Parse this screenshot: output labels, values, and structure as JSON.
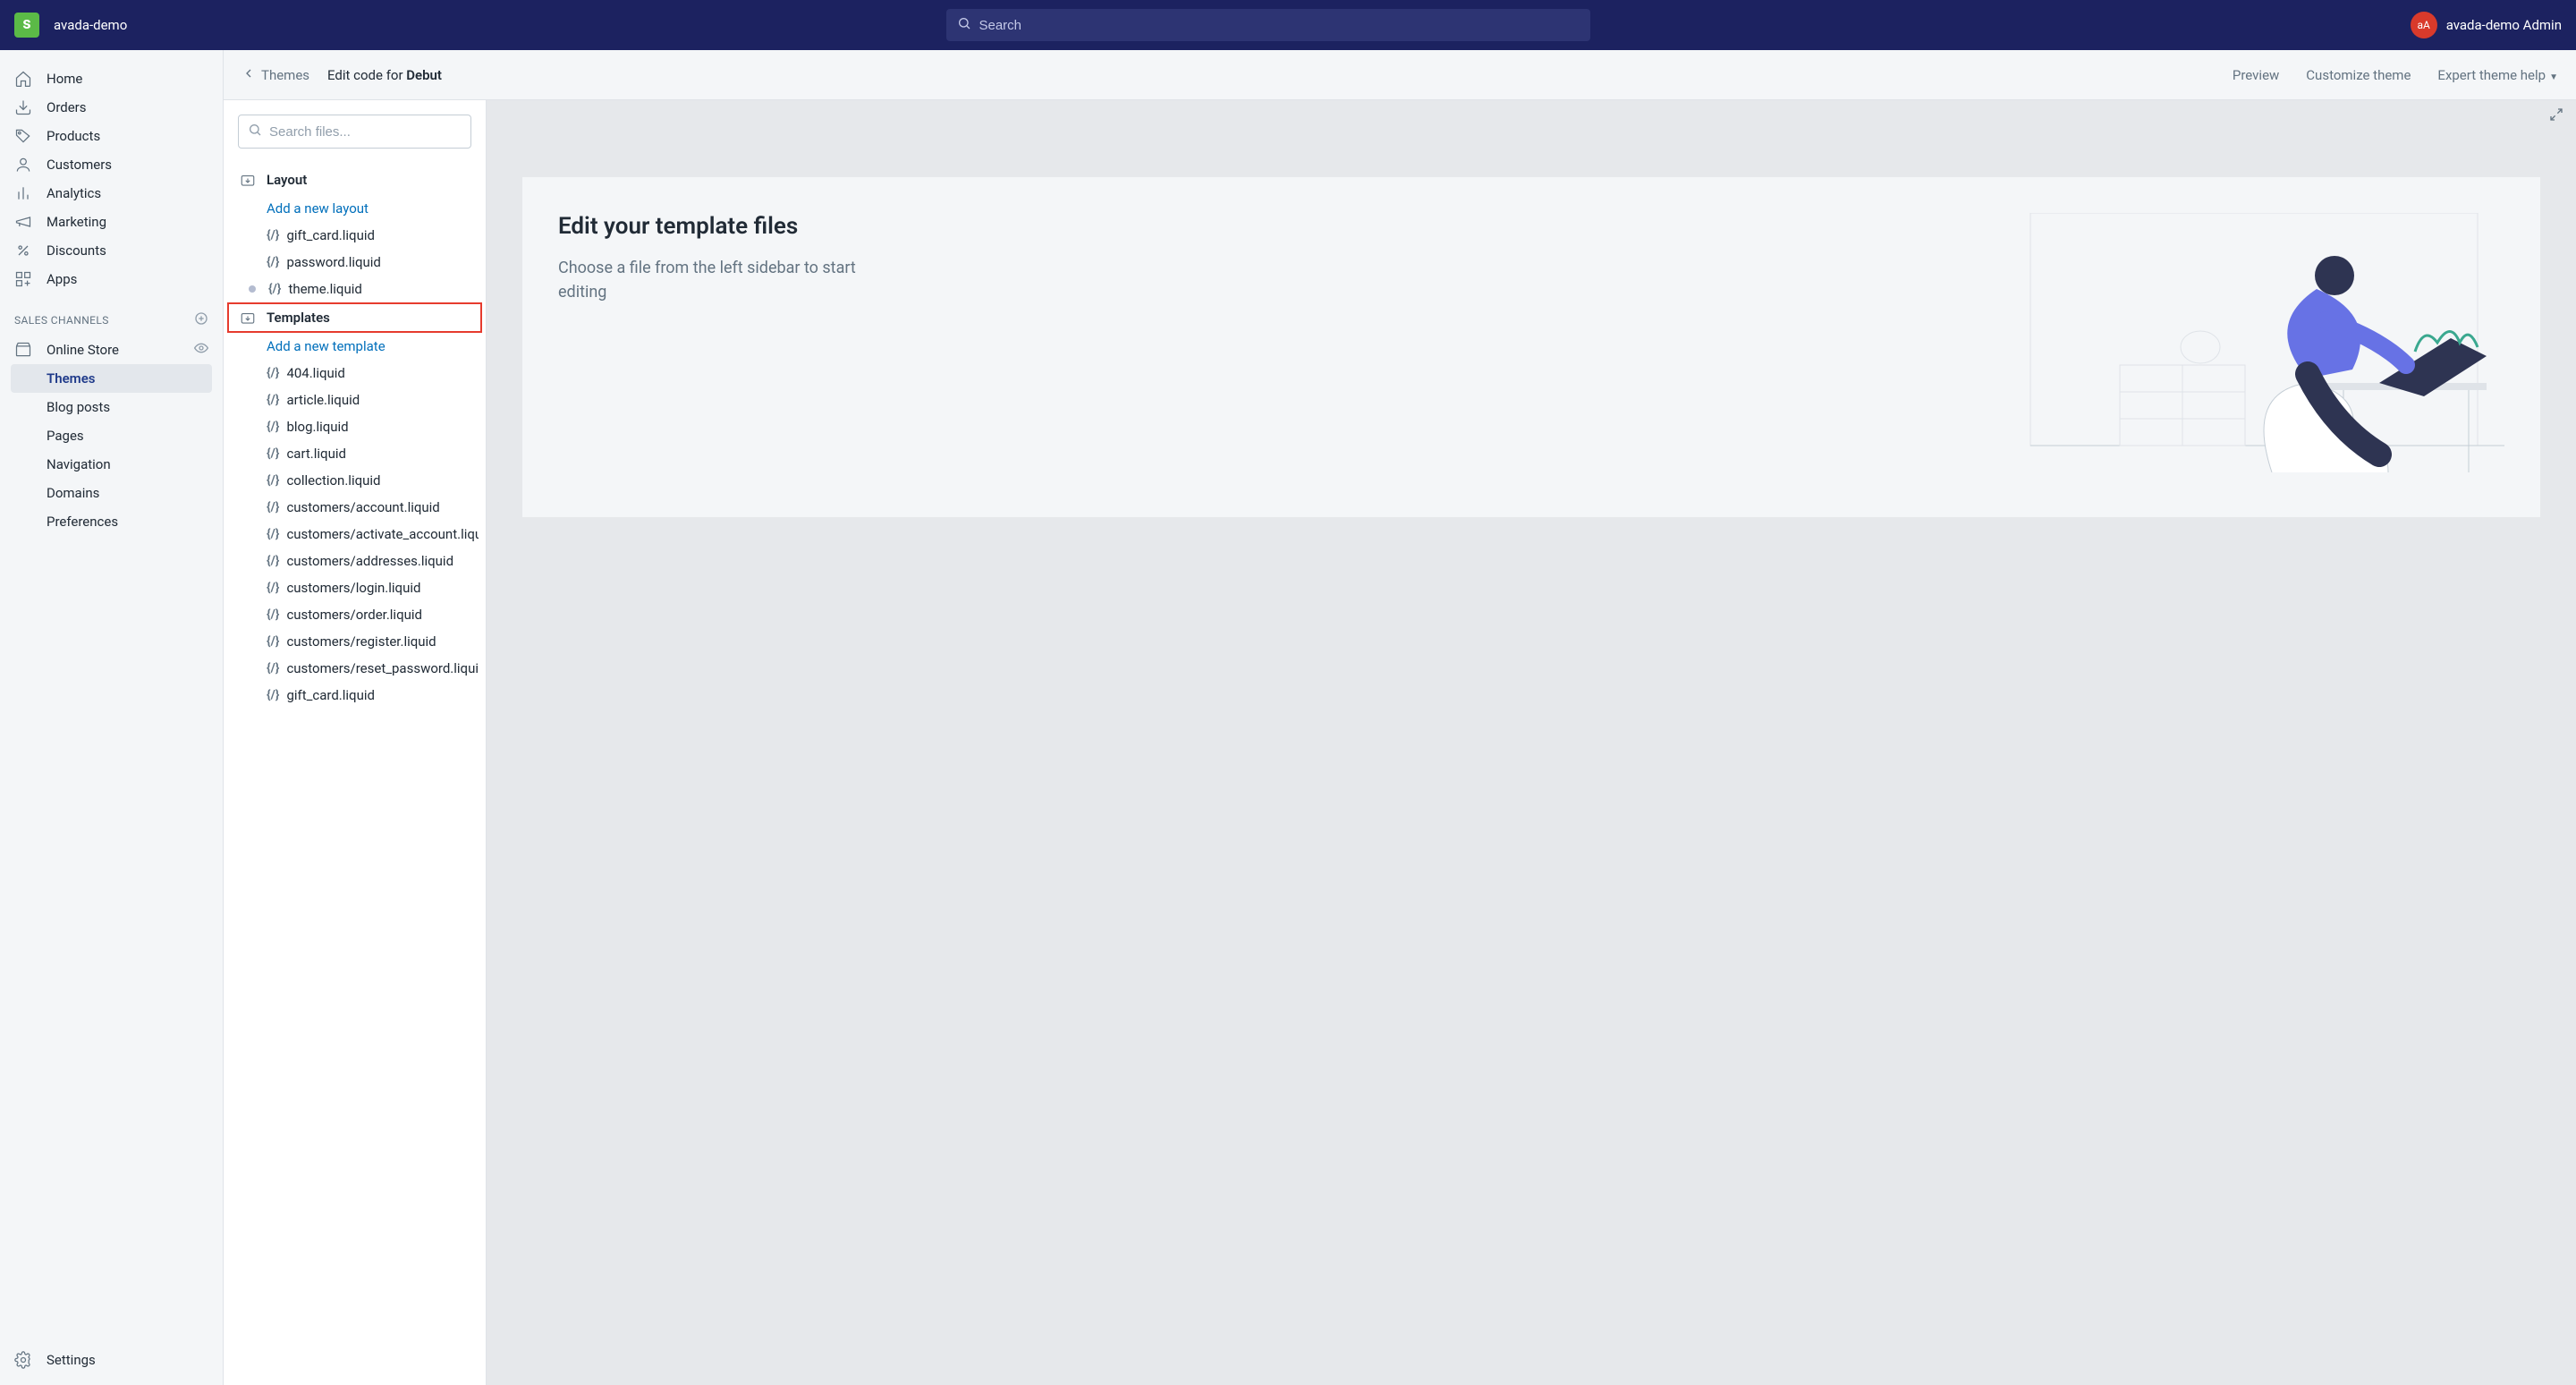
{
  "topbar": {
    "store_name": "avada-demo",
    "search_placeholder": "Search",
    "avatar_initials": "aA",
    "admin_name": "avada-demo Admin"
  },
  "nav": {
    "items": [
      {
        "label": "Home",
        "icon": "home"
      },
      {
        "label": "Orders",
        "icon": "orders"
      },
      {
        "label": "Products",
        "icon": "products"
      },
      {
        "label": "Customers",
        "icon": "customers"
      },
      {
        "label": "Analytics",
        "icon": "analytics"
      },
      {
        "label": "Marketing",
        "icon": "marketing"
      },
      {
        "label": "Discounts",
        "icon": "discounts"
      },
      {
        "label": "Apps",
        "icon": "apps"
      }
    ],
    "sales_channels_label": "SALES CHANNELS",
    "online_store_label": "Online Store",
    "subitems": [
      {
        "label": "Themes",
        "active": true
      },
      {
        "label": "Blog posts"
      },
      {
        "label": "Pages"
      },
      {
        "label": "Navigation"
      },
      {
        "label": "Domains"
      },
      {
        "label": "Preferences"
      }
    ],
    "settings_label": "Settings"
  },
  "page_header": {
    "back_label": "Themes",
    "title_prefix": "Edit code for ",
    "title_bold": "Debut",
    "actions": {
      "preview": "Preview",
      "customize": "Customize theme",
      "expert": "Expert theme help"
    }
  },
  "file_rail": {
    "search_placeholder": "Search files...",
    "groups": [
      {
        "title": "Layout",
        "add_label": "Add a new layout",
        "highlight": false,
        "files": [
          {
            "name": "gift_card.liquid"
          },
          {
            "name": "password.liquid"
          },
          {
            "name": "theme.liquid",
            "dirty": true
          }
        ]
      },
      {
        "title": "Templates",
        "add_label": "Add a new template",
        "highlight": true,
        "files": [
          {
            "name": "404.liquid"
          },
          {
            "name": "article.liquid"
          },
          {
            "name": "blog.liquid"
          },
          {
            "name": "cart.liquid"
          },
          {
            "name": "collection.liquid"
          },
          {
            "name": "customers/account.liquid"
          },
          {
            "name": "customers/activate_account.liquid"
          },
          {
            "name": "customers/addresses.liquid"
          },
          {
            "name": "customers/login.liquid"
          },
          {
            "name": "customers/order.liquid"
          },
          {
            "name": "customers/register.liquid"
          },
          {
            "name": "customers/reset_password.liquid"
          },
          {
            "name": "gift_card.liquid"
          }
        ]
      }
    ]
  },
  "canvas": {
    "heading": "Edit your template files",
    "body": "Choose a file from the left sidebar to start editing"
  }
}
